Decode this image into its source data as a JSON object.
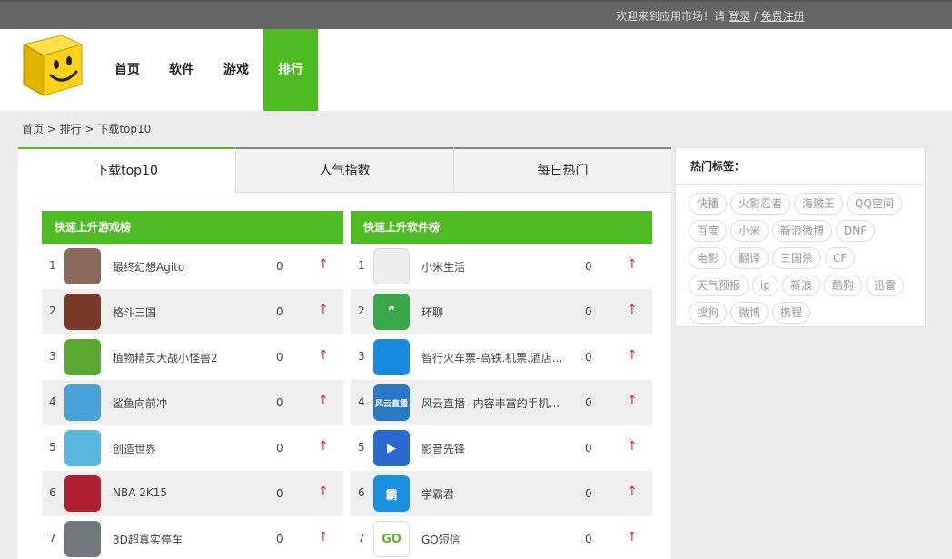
{
  "topbar": {
    "welcome": "欢迎来到应用市场！请",
    "login": "登录",
    "sep": "/",
    "register": "免费注册"
  },
  "nav": [
    "首页",
    "软件",
    "游戏",
    "排行"
  ],
  "nav_active": 3,
  "breadcrumb": "首页 > 排行 > 下载top10",
  "tabs": [
    "下载top10",
    "人气指数",
    "每日热门"
  ],
  "games": {
    "title": "快速上升游戏榜",
    "items": [
      {
        "rank": "1",
        "name": "最终幻想Agito",
        "count": "0",
        "icon_color": "#8a6a5a",
        "icon_text": ""
      },
      {
        "rank": "2",
        "name": "格斗三国",
        "count": "0",
        "icon_color": "#7a3a2a",
        "icon_text": ""
      },
      {
        "rank": "3",
        "name": "植物精灵大战小怪兽2",
        "count": "0",
        "icon_color": "#5aa830",
        "icon_text": ""
      },
      {
        "rank": "4",
        "name": "鲨鱼向前冲",
        "count": "0",
        "icon_color": "#4aa0d8",
        "icon_text": ""
      },
      {
        "rank": "5",
        "name": "创造世界",
        "count": "0",
        "icon_color": "#5ab8e0",
        "icon_text": ""
      },
      {
        "rank": "6",
        "name": "NBA 2K15",
        "count": "0",
        "icon_color": "#b02030",
        "icon_text": ""
      },
      {
        "rank": "7",
        "name": "3D超真实停车",
        "count": "0",
        "icon_color": "#707880",
        "icon_text": ""
      }
    ]
  },
  "apps": {
    "title": "快速上升软件榜",
    "items": [
      {
        "rank": "1",
        "name": "小米生活",
        "count": "0",
        "icon_color": "#eeeeee",
        "icon_text": ""
      },
      {
        "rank": "2",
        "name": "环聊",
        "count": "0",
        "icon_color": "#3aa84a",
        "icon_text": "”"
      },
      {
        "rank": "3",
        "name": "智行火车票-高铁.机票.酒店...",
        "count": "0",
        "icon_color": "#1a8ae0",
        "icon_text": ""
      },
      {
        "rank": "4",
        "name": "风云直播--内容丰富的手机...",
        "count": "0",
        "icon_color": "#2a78c8",
        "icon_text": "风云直播"
      },
      {
        "rank": "5",
        "name": "影音先锋",
        "count": "0",
        "icon_color": "#2a6ad0",
        "icon_text": "▶"
      },
      {
        "rank": "6",
        "name": "学霸君",
        "count": "0",
        "icon_color": "#1a90e0",
        "icon_text": "霸"
      },
      {
        "rank": "7",
        "name": "GO短信",
        "count": "0",
        "icon_color": "#ffffff",
        "icon_text": "GO"
      }
    ]
  },
  "arrow_glyph": "↑",
  "sidebar": {
    "title": "热门标签：",
    "tags": [
      "快播",
      "火影忍者",
      "海贼王",
      "QQ空间",
      "百度",
      "小米",
      "新浪微博",
      "DNF",
      "电影",
      "翻译",
      "三国杀",
      "CF",
      "天气预报",
      "ip",
      "新浪",
      "酷狗",
      "迅雷",
      "搜狗",
      "微博",
      "携程"
    ]
  }
}
